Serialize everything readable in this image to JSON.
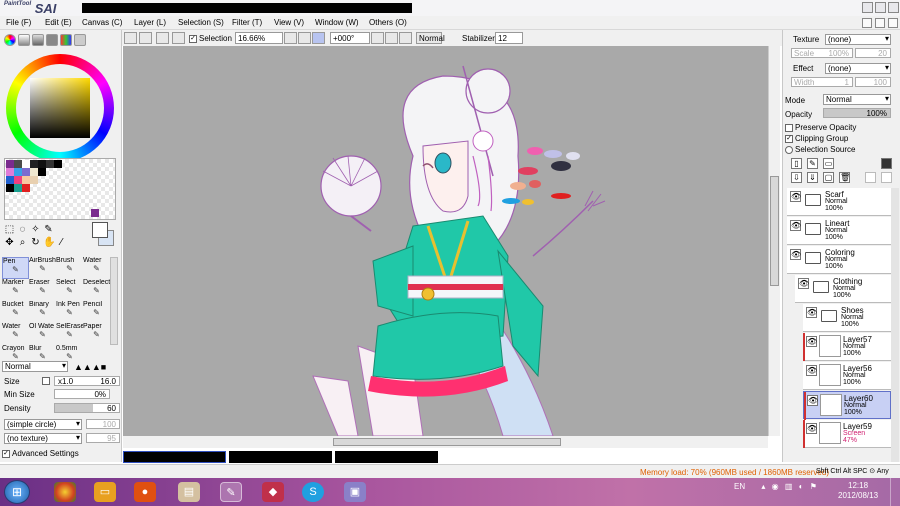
{
  "app": {
    "logo_text": "SAI",
    "logo_small": "PaintTool"
  },
  "menu": {
    "items": [
      "File (F)",
      "Edit (E)",
      "Canvas (C)",
      "Layer (L)",
      "Selection (S)",
      "Filter (T)",
      "View (V)",
      "Window (W)",
      "Others (O)"
    ]
  },
  "toolbar": {
    "selection_label": "Selection",
    "zoom": "16.66%",
    "rotation": "+000°",
    "blend": "Normal",
    "stabilizer_label": "Stabilizer",
    "stabilizer_value": "12"
  },
  "brushes": [
    {
      "label": "Pen",
      "icon": "pen-icon",
      "active": true
    },
    {
      "label": "AirBrush",
      "icon": "airbrush-icon"
    },
    {
      "label": "Brush",
      "icon": "brush-icon"
    },
    {
      "label": "Water",
      "icon": "water-icon"
    },
    {
      "label": "Marker",
      "icon": "marker-icon"
    },
    {
      "label": "Eraser",
      "icon": "eraser-icon"
    },
    {
      "label": "Select",
      "icon": "select-icon"
    },
    {
      "label": "Deselect",
      "icon": "deselect-icon"
    },
    {
      "label": "Bucket",
      "icon": "bucket-icon"
    },
    {
      "label": "Binary",
      "icon": "binary-icon"
    },
    {
      "label": "Ink Pen",
      "icon": "inkpen-icon"
    },
    {
      "label": "Pencil",
      "icon": "pencil-icon"
    },
    {
      "label": "Water",
      "icon": "water-icon"
    },
    {
      "label": "Ol Wate",
      "icon": "oilwater-icon"
    },
    {
      "label": "SelErase",
      "icon": "selerase-icon"
    },
    {
      "label": "Paper",
      "icon": "paper-icon"
    },
    {
      "label": "Crayon",
      "icon": "crayon-icon"
    },
    {
      "label": "Blur",
      "icon": "blur-icon"
    },
    {
      "label": "0.5mm",
      "icon": "mechpencil-icon"
    }
  ],
  "brush_settings": {
    "mode": "Normal",
    "size_label": "Size",
    "size_multiplier": "x1.0",
    "size_value": "16.0",
    "minsize_label": "Min Size",
    "minsize_value": "0%",
    "density_label": "Density",
    "density_value": "60",
    "shape": "(simple circle)",
    "shape_value": "100",
    "texture": "(no texture)",
    "texture_value": "95",
    "advanced_label": "Advanced Settings"
  },
  "right_panel": {
    "texture_label": "Texture",
    "texture_value": "(none)",
    "texture_scale_label": "Scale",
    "texture_scale_value": "100%",
    "texture_scale_num": "20",
    "effect_label": "Effect",
    "effect_value": "(none)",
    "effect_width_label": "Width",
    "effect_width_value": "1",
    "effect_width_num": "100",
    "mode_label": "Mode",
    "mode_value": "Normal",
    "opacity_label": "Opacity",
    "opacity_value": "100%",
    "preserve_opacity": "Preserve Opacity",
    "clipping_group": "Clipping Group",
    "selection_source": "Selection Source"
  },
  "layers": [
    {
      "name": "Scarf",
      "mode": "Normal",
      "opacity": "100%",
      "type": "folder",
      "indent": 0
    },
    {
      "name": "Lineart",
      "mode": "Normal",
      "opacity": "100%",
      "type": "folder",
      "indent": 0
    },
    {
      "name": "Coloring",
      "mode": "Normal",
      "opacity": "100%",
      "type": "folder",
      "indent": 0
    },
    {
      "name": "Clothing",
      "mode": "Normal",
      "opacity": "100%",
      "type": "folder",
      "indent": 1
    },
    {
      "name": "Shoes",
      "mode": "Normal",
      "opacity": "100%",
      "type": "folder",
      "indent": 2
    },
    {
      "name": "Layer57",
      "mode": "Normal",
      "opacity": "100%",
      "type": "layer",
      "indent": 2,
      "clip": true
    },
    {
      "name": "Layer56",
      "mode": "Normal",
      "opacity": "100%",
      "type": "layer",
      "indent": 2
    },
    {
      "name": "Layer60",
      "mode": "Normal",
      "opacity": "100%",
      "type": "layer",
      "indent": 2,
      "selected": true,
      "clip": true
    },
    {
      "name": "Layer59",
      "mode": "Screen",
      "opacity": "47%",
      "type": "layer",
      "indent": 2,
      "clip": true
    }
  ],
  "status": {
    "memory": "Memory load: 70% (960MB used / 1860MB reserved)",
    "keys": "Shft Ctrl Alt SPC ⊙ Any"
  },
  "taskbar": {
    "lang": "EN",
    "time": "12:18",
    "date": "2012/08/13"
  },
  "colors": {
    "memory_text": "#e06000",
    "selected_layer": "#c8d0f4",
    "canvas_bg": "#a9a9a9",
    "clip_bar": "#d03030"
  }
}
